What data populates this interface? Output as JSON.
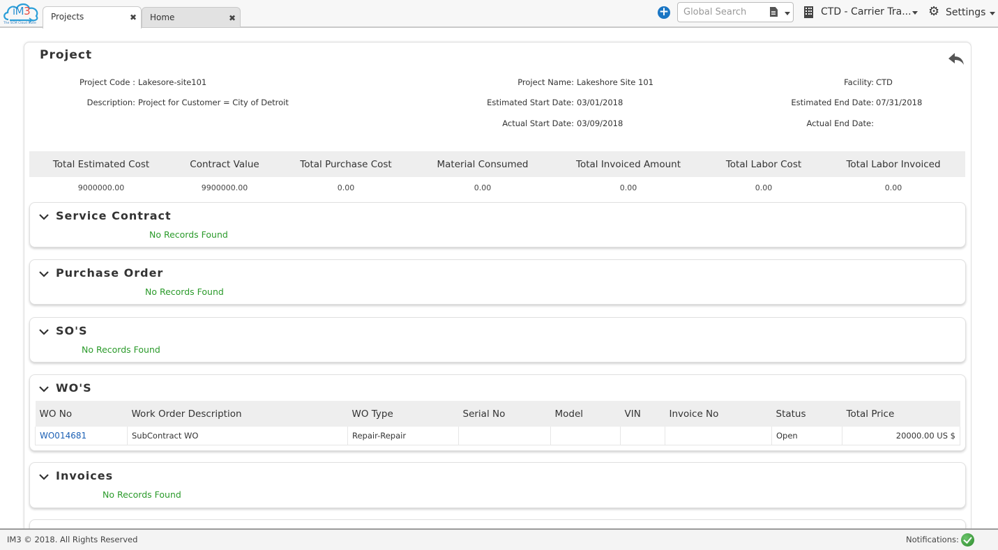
{
  "app": {
    "logo_text": "iM",
    "logo_text_accent": "3",
    "logo_tagline": "The SCM Cloud Suite"
  },
  "tabs": [
    {
      "label": "Projects",
      "close": "✖",
      "active": true
    },
    {
      "label": "Home",
      "close": "✖",
      "active": false
    }
  ],
  "header": {
    "add_icon": "plus-circle-icon",
    "search_placeholder": "Global Search",
    "search_value": "",
    "search_type_icon": "document-icon",
    "facility_icon": "building-icon",
    "facility_label": "CTD - Carrier Tra...",
    "settings_icon": "gear-icon",
    "settings_label": "Settings"
  },
  "project": {
    "title": "Project",
    "back_icon": "reply-arrow-icon",
    "fields": {
      "project_code": {
        "label": "Project Code :",
        "value": "Lakesore-site101"
      },
      "description": {
        "label": "Description:",
        "value": "Project for Customer = City of Detroit"
      },
      "project_name": {
        "label": "Project Name:",
        "value": "Lakeshore Site 101"
      },
      "est_start": {
        "label": "Estimated Start Date:",
        "value": "03/01/2018"
      },
      "actual_start": {
        "label": "Actual Start Date:",
        "value": "03/09/2018"
      },
      "facility": {
        "label": "Facility:",
        "value": "CTD"
      },
      "est_end": {
        "label": "Estimated End Date:",
        "value": "07/31/2018"
      },
      "actual_end": {
        "label": "Actual End Date:",
        "value": ""
      }
    }
  },
  "summary": {
    "headers": [
      "Total Estimated Cost",
      "Contract Value",
      "Total Purchase Cost",
      "Material Consumed",
      "Total Invoiced Amount",
      "Total Labor Cost",
      "Total Labor Invoiced"
    ],
    "values": [
      "9000000.00",
      "9900000.00",
      "0.00",
      "0.00",
      "0.00",
      "0.00",
      "0.00"
    ]
  },
  "sections": {
    "service_contract": {
      "title": "Service Contract",
      "empty": "No Records Found"
    },
    "purchase_order": {
      "title": "Purchase Order",
      "empty": "No Records Found"
    },
    "sos": {
      "title": "SO'S",
      "empty": "No Records Found"
    },
    "wos": {
      "title": "WO'S",
      "columns": [
        "WO No",
        "Work Order Description",
        "WO Type",
        "Serial No",
        "Model",
        "VIN",
        "Invoice No",
        "Status",
        "Total Price"
      ],
      "rows": [
        [
          "WO014681",
          "SubContract WO",
          "Repair-Repair",
          "",
          "",
          "",
          "",
          "Open",
          "20000.00 US $"
        ]
      ]
    },
    "invoices": {
      "title": "Invoices",
      "empty": "No Records Found"
    }
  },
  "footer": {
    "copyright": "IM3 © 2018. All Rights Reserved",
    "notifications_label": "Notifications:",
    "notifications_icon": "check-circle-icon",
    "status_color": "#3a9a3a"
  },
  "colors": {
    "accent_blue": "#1a76c4",
    "link_blue": "#1a5fb4",
    "empty_green": "#2a9a2a"
  }
}
